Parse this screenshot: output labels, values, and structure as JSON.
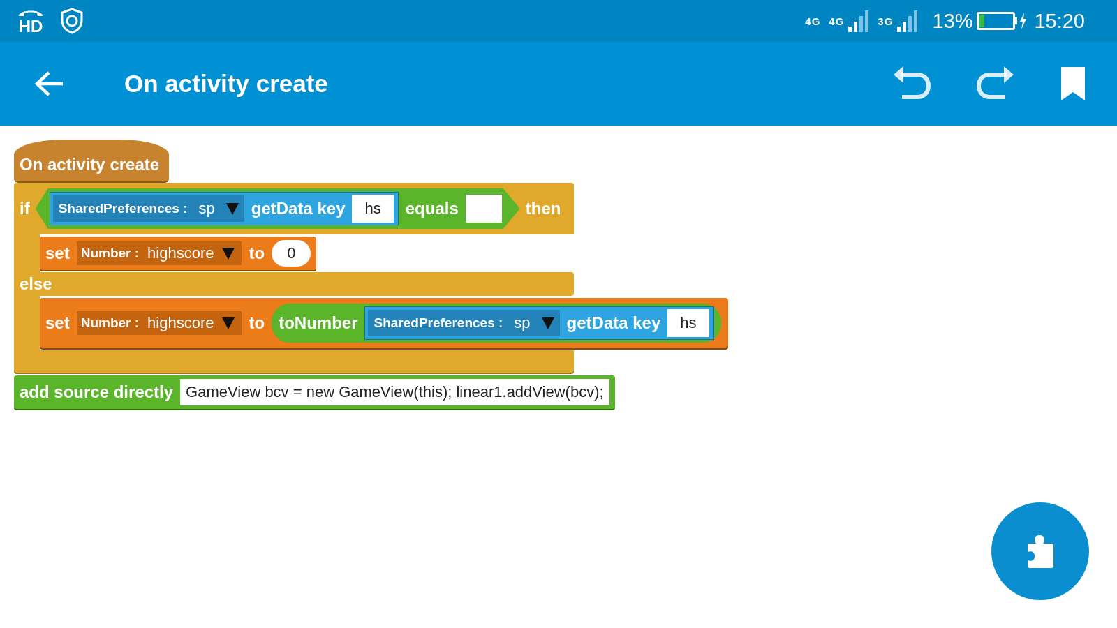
{
  "status_bar": {
    "hd_label": "HD",
    "network_labels": [
      "4G",
      "4G",
      "3G"
    ],
    "battery": "13%",
    "time": "15:20"
  },
  "app_bar": {
    "title": "On activity create"
  },
  "event": {
    "label": "On activity create"
  },
  "if_block": {
    "keyword": "if",
    "then_keyword": "then",
    "else_keyword": "else",
    "condition": {
      "object_type": "SharedPreferences :",
      "object_name": "sp",
      "method": "getData key",
      "key": "hs",
      "operator": "equals"
    },
    "then_branch": {
      "keyword": "set",
      "var_type": "Number :",
      "var_name": "highscore",
      "to": "to",
      "value": "0"
    },
    "else_branch": {
      "keyword": "set",
      "var_type": "Number :",
      "var_name": "highscore",
      "to": "to",
      "convert": "toNumber",
      "object_type": "SharedPreferences :",
      "object_name": "sp",
      "method": "getData key",
      "key": "hs"
    }
  },
  "source_block": {
    "keyword": "add source directly",
    "code": "GameView bcv = new GameView(this); linear1.addView(bcv);"
  }
}
